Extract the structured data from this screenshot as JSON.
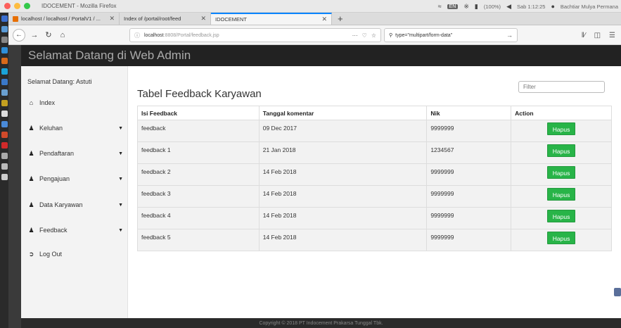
{
  "window": {
    "title": "IDOCEMENT - Mozilla Firefox"
  },
  "statusbar": {
    "battery": "(100%)",
    "time": "Sab 1:12:25",
    "user": "Bachtiar Mulya Permana",
    "lang": "EN"
  },
  "browser": {
    "tabs": [
      {
        "label": "localhost / localhost / PortalV1 / ..."
      },
      {
        "label": "Index of /portal/root/feed"
      },
      {
        "label": "IDOCEMENT"
      }
    ],
    "url_host": "localhost",
    "url_path": ":8808/Portal/feedback.jsp",
    "search_value": "type=\"multipart/form-data\""
  },
  "app": {
    "header_title": "Selamat Datang di Web Admin"
  },
  "sidebar": {
    "welcome": "Selamat Datang: Astuti",
    "items": [
      {
        "label": "Index",
        "icon": "home-icon"
      },
      {
        "label": "Keluhan",
        "icon": "users-icon"
      },
      {
        "label": "Pendaftaran",
        "icon": "users-icon"
      },
      {
        "label": "Pengajuan",
        "icon": "users-icon"
      },
      {
        "label": "Data Karyawan",
        "icon": "users-icon"
      },
      {
        "label": "Feedback",
        "icon": "users-icon"
      },
      {
        "label": "Log Out",
        "icon": "logout-icon"
      }
    ]
  },
  "content": {
    "title": "Tabel Feedback Karyawan",
    "filter_placeholder": "Filter",
    "columns": [
      "Isi Feedback",
      "Tanggal komentar",
      "Nik",
      "Action"
    ],
    "rows": [
      {
        "isi": "feedback",
        "tanggal": "09 Dec 2017",
        "nik": "9999999"
      },
      {
        "isi": "feedback 1",
        "tanggal": "21 Jan 2018",
        "nik": "1234567"
      },
      {
        "isi": "feedback 2",
        "tanggal": "14 Feb 2018",
        "nik": "9999999"
      },
      {
        "isi": "feedback 3",
        "tanggal": "14 Feb 2018",
        "nik": "9999999"
      },
      {
        "isi": "feedback 4",
        "tanggal": "14 Feb 2018",
        "nik": "9999999"
      },
      {
        "isi": "feedback 5",
        "tanggal": "14 Feb 2018",
        "nik": "9999999"
      }
    ],
    "action_label": "Hapus"
  },
  "footer": {
    "text": "Copyright © 2018 PT Indocement Prakarsa Tunggal Tbk."
  },
  "colors": {
    "action_green": "#28b448",
    "header_dark": "#222222",
    "tab_accent": "#0a84ff"
  }
}
